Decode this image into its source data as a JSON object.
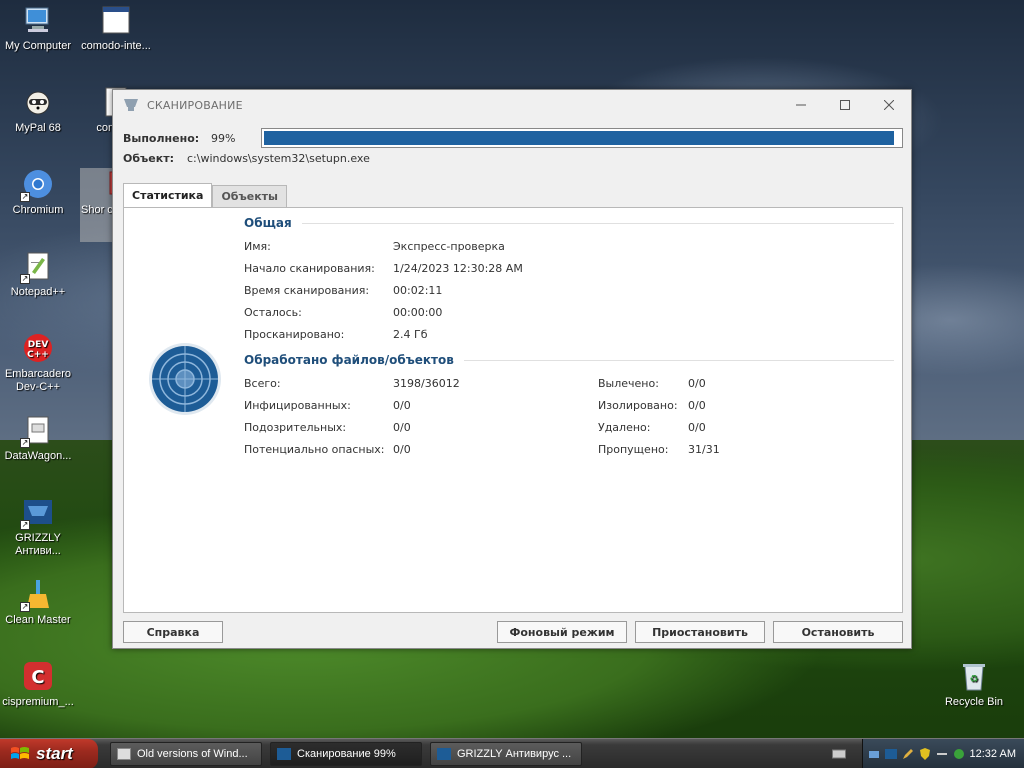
{
  "desktop": {
    "icons": [
      {
        "label": "My Computer"
      },
      {
        "label": "comodo-inte..."
      },
      {
        "label": "MyPal 68"
      },
      {
        "label": "comodo"
      },
      {
        "label": "Chromium"
      },
      {
        "label": "Shor cispren ta"
      },
      {
        "label": "Notepad++"
      },
      {
        "label": "Embarcadero Dev-C++"
      },
      {
        "label": "DataWagon..."
      },
      {
        "label": "GRIZZLY Антиви..."
      },
      {
        "label": "Clean Master"
      },
      {
        "label": "cispremium_..."
      },
      {
        "label": "Recycle Bin"
      }
    ]
  },
  "window": {
    "title": "СКАНИРОВАНИЕ",
    "progress_label": "Выполнено:",
    "progress_value": "99%",
    "progress_fraction": 0.99,
    "object_label": "Объект:",
    "object_value": "c:\\windows\\system32\\setupn.exe",
    "tabs": [
      {
        "label": "Статистика",
        "active": true
      },
      {
        "label": "Объекты",
        "active": false
      }
    ],
    "general": {
      "title": "Общая",
      "rows": [
        {
          "key": "Имя:",
          "value": "Экспресс-проверка"
        },
        {
          "key": "Начало сканирования:",
          "value": "1/24/2023 12:30:28 AM"
        },
        {
          "key": "Время сканирования:",
          "value": "00:02:11"
        },
        {
          "key": "Осталось:",
          "value": "00:00:00"
        },
        {
          "key": "Просканировано:",
          "value": "2.4 Гб"
        }
      ]
    },
    "processed": {
      "title": "Обработано файлов/объектов",
      "left": [
        {
          "key": "Всего:",
          "value": "3198/36012"
        },
        {
          "key": "Инфицированных:",
          "value": "0/0"
        },
        {
          "key": "Подозрительных:",
          "value": "0/0"
        },
        {
          "key": "Потенциально опасных:",
          "value": "0/0"
        }
      ],
      "right": [
        {
          "key": "Вылечено:",
          "value": "0/0"
        },
        {
          "key": "Изолировано:",
          "value": "0/0"
        },
        {
          "key": "Удалено:",
          "value": "0/0"
        },
        {
          "key": "Пропущено:",
          "value": "31/31"
        }
      ]
    },
    "buttons": {
      "help": "Справка",
      "background": "Фоновый режим",
      "pause": "Приостановить",
      "stop": "Остановить"
    }
  },
  "taskbar": {
    "start_label": "start",
    "items": [
      {
        "label": "Old versions of Wind..."
      },
      {
        "label": "Сканирование 99%"
      },
      {
        "label": "GRIZZLY Антивирус ..."
      }
    ],
    "clock": "12:32 AM"
  },
  "colors": {
    "accent": "#1f62a0",
    "section_title": "#1f4e7a"
  }
}
